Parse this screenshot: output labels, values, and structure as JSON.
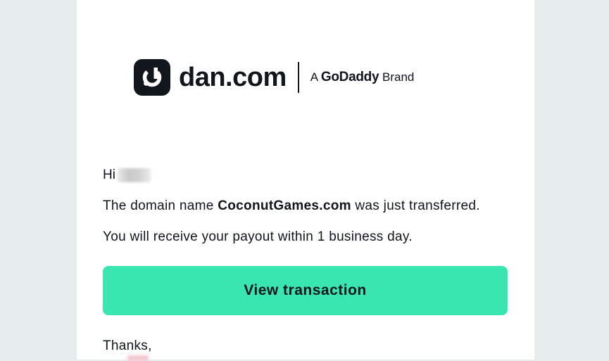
{
  "logo": {
    "wordmark": "dan.com",
    "brand_prefix": "A",
    "brand_name": "GoDaddy",
    "brand_suffix": "Brand",
    "mark_color": "#11151c"
  },
  "email": {
    "greeting": "Hi",
    "transfer_prefix": "The domain name",
    "domain_name": "CoconutGames.com",
    "transfer_suffix": "was just transferred.",
    "payout_message": "You will receive your payout within 1 business day.",
    "button_label": "View transaction",
    "signoff": "Thanks,"
  },
  "colors": {
    "background": "#e6ecec",
    "card": "#ffffff",
    "button": "#3ae6b0",
    "text": "#11151c"
  }
}
